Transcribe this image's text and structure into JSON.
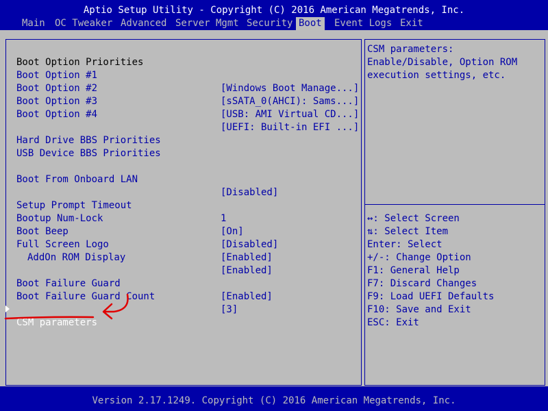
{
  "title": "Aptio Setup Utility - Copyright (C) 2016 American Megatrends, Inc.",
  "menu": [
    {
      "label": "Main"
    },
    {
      "label": "OC Tweaker"
    },
    {
      "label": "Advanced"
    },
    {
      "label": "Server Mgmt"
    },
    {
      "label": "Security"
    },
    {
      "label": "Boot"
    },
    {
      "label": "Event Logs"
    },
    {
      "label": "Exit"
    }
  ],
  "active_tab": "Boot",
  "settings": {
    "section_title": "Boot Option Priorities",
    "boot_option_1": {
      "label": "Boot Option #1",
      "value": "[Windows Boot Manage...]"
    },
    "boot_option_2": {
      "label": "Boot Option #2",
      "value": "[sSATA_0(AHCI): Sams...]"
    },
    "boot_option_3": {
      "label": "Boot Option #3",
      "value": "[USB: AMI Virtual CD...]"
    },
    "boot_option_4": {
      "label": "Boot Option #4",
      "value": "[UEFI: Built-in EFI ...]"
    },
    "hdd_bbs": {
      "label": "Hard Drive BBS Priorities"
    },
    "usb_bbs": {
      "label": "USB Device BBS Priorities"
    },
    "onboard_lan": {
      "label": "Boot From Onboard LAN",
      "value": "[Disabled]"
    },
    "prompt_timeout": {
      "label": "Setup Prompt Timeout",
      "value": "1"
    },
    "numlock": {
      "label": "Bootup Num-Lock",
      "value": "[On]"
    },
    "beep": {
      "label": "Boot Beep",
      "value": "[Disabled]"
    },
    "logo": {
      "label": "Full Screen Logo",
      "value": "[Enabled]"
    },
    "addon_rom": {
      "label": "AddOn ROM Display",
      "value": "[Enabled]"
    },
    "failure_guard": {
      "label": "Boot Failure Guard",
      "value": "[Enabled]"
    },
    "failure_guard_count": {
      "label": "Boot Failure Guard Count",
      "value": "[3]"
    },
    "csm": {
      "label": "CSM parameters"
    }
  },
  "help_text": [
    "CSM parameters:",
    "Enable/Disable, Option ROM",
    "execution settings, etc."
  ],
  "keys": [
    "↔: Select Screen",
    "⇅: Select Item",
    "Enter: Select",
    "+/-: Change Option",
    "F1: General Help",
    "F7: Discard Changes",
    "F9: Load UEFI Defaults",
    "F10: Save and Exit",
    "ESC: Exit"
  ],
  "footer": "Version 2.17.1249. Copyright (C) 2016 American Megatrends, Inc.",
  "colors": {
    "background": "#0000a8",
    "panel": "#bcbcbc",
    "text_primary": "#0000a8",
    "highlight": "#ffffff",
    "annotation": "#e00000"
  }
}
